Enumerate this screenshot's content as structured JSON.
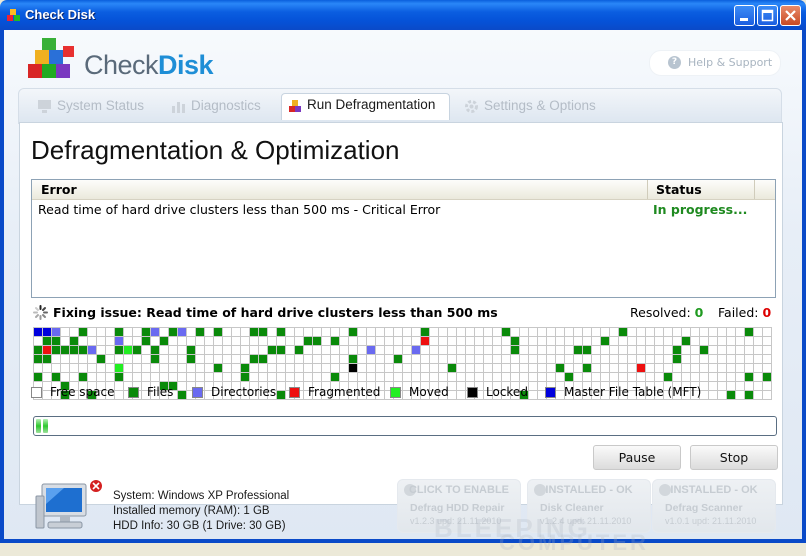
{
  "window": {
    "title": "Check Disk"
  },
  "brand": {
    "part1": "Check",
    "part2": "Disk"
  },
  "help": {
    "label": "Help & Support"
  },
  "tabs": [
    {
      "label": "System Status",
      "icon": "monitor-icon"
    },
    {
      "label": "Diagnostics",
      "icon": "chart-icon"
    },
    {
      "label": "Run Defragmentation",
      "icon": "cubes-icon",
      "active": true
    },
    {
      "label": "Settings & Options",
      "icon": "gear-icon"
    }
  ],
  "main": {
    "heading": "Defragmentation & Optimization",
    "table": {
      "headers": {
        "error": "Error",
        "status": "Status"
      },
      "rows": [
        {
          "error": "Read time of hard drive clusters less than 500 ms - Critical Error",
          "status": "In progress..."
        }
      ]
    },
    "fixing": {
      "text": "Fixing issue: Read time of hard drive clusters less than 500 ms",
      "resolved_label": "Resolved:",
      "resolved_value": "0",
      "failed_label": "Failed:",
      "failed_value": "0"
    },
    "cluster_map": {
      "rows": [
        "MMD..F...F..FD.FD.F.F...FF.F.......F.......F........F............F.............F..",
        ".FF.F....D..F.F...............FF.F.........R.........F.........F........F.........F",
        "FRFFFFD..FGF.F...F........FF.F.......D....D..........F......FF.........F..F.......",
        "FF.....F.....F...F......FF.........F....F..............................F...........",
        ".........G..........F..F...........L..........F...........F..F.....R...............",
        "F.F..F...F.............F.........F.........................F..........F........F.F...",
        "...F..........FF.....................................................................",
        "...F..F.........F..........F..........................F......................F.F...."
      ],
      "legend": [
        {
          "label": "Free space",
          "color": "#ffffff"
        },
        {
          "label": "Files",
          "color": "#0a8a0a"
        },
        {
          "label": "Directories",
          "color": "#6a6af0"
        },
        {
          "label": "Fragmented",
          "color": "#ee1010"
        },
        {
          "label": "Moved",
          "color": "#22ee22"
        },
        {
          "label": "Locked",
          "color": "#000000"
        },
        {
          "label": "Master File Table (MFT)",
          "color": "#0000dd"
        }
      ]
    },
    "progress": {
      "fraction": 0.02
    },
    "buttons": {
      "pause": "Pause",
      "stop": "Stop"
    }
  },
  "footer": {
    "system": [
      "System: Windows XP Professional",
      "Installed memory (RAM): 1 GB",
      "HDD Info: 30 GB (1 Drive: 30 GB)"
    ],
    "promos": [
      {
        "status": "CLICK TO ENABLE",
        "name": "Defrag HDD Repair",
        "version": "v1.2.3 upd: 21.11.2010"
      },
      {
        "status": "INSTALLED - OK",
        "name": "Disk Cleaner",
        "version": "v1.2.4 upd: 21.11.2010"
      },
      {
        "status": "INSTALLED - OK",
        "name": "Defrag Scanner",
        "version": "v1.0.1 upd: 21.11.2010"
      }
    ],
    "watermark": [
      "BLEEPING",
      "COMPUTER"
    ]
  }
}
